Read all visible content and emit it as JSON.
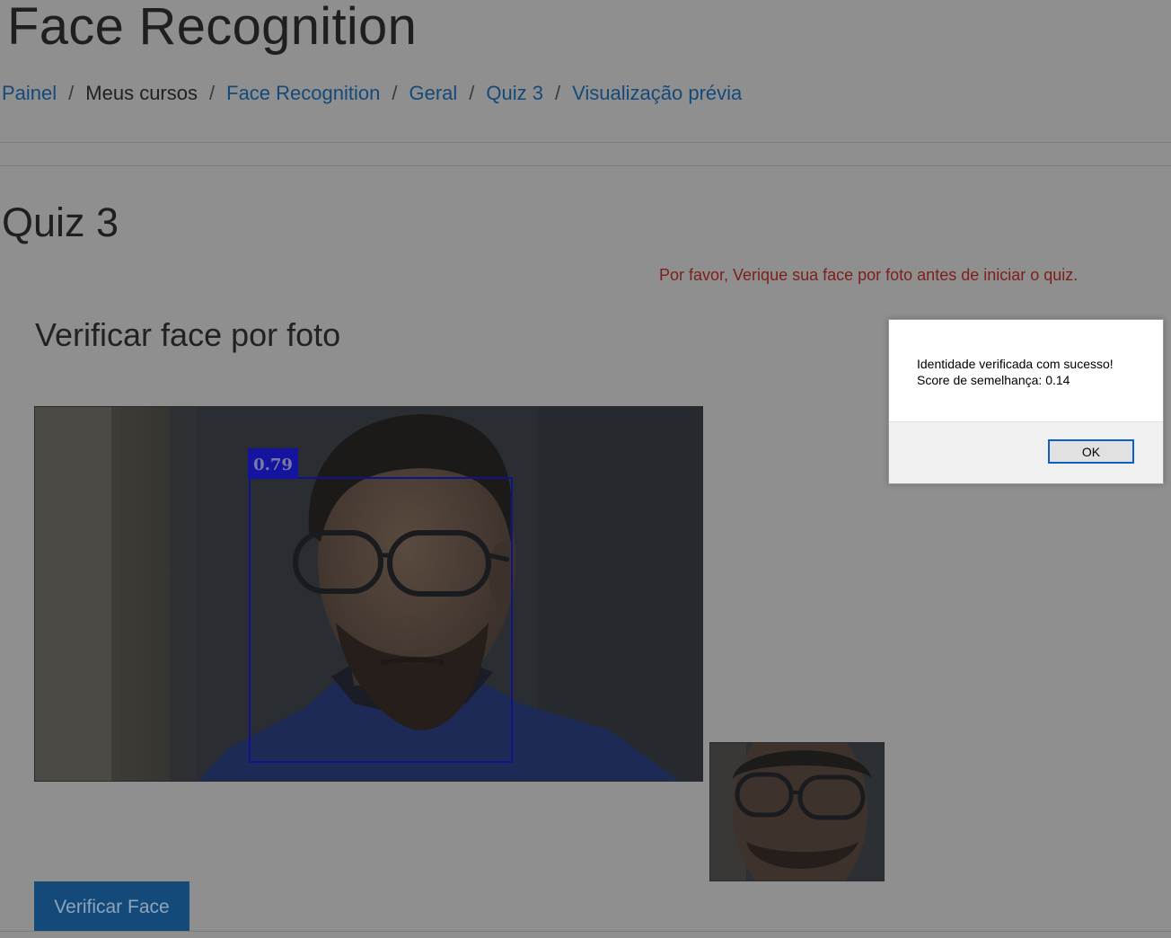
{
  "page": {
    "title": "Face Recognition"
  },
  "breadcrumb": {
    "items": [
      {
        "label": "Painel",
        "link": true
      },
      {
        "label": "Meus cursos",
        "link": false
      },
      {
        "label": "Face Recognition",
        "link": true
      },
      {
        "label": "Geral",
        "link": true
      },
      {
        "label": "Quiz 3",
        "link": true
      },
      {
        "label": "Visualização prévia",
        "link": true
      }
    ],
    "separator": "/"
  },
  "quiz": {
    "title": "Quiz 3",
    "warning": "Por favor, Verique sua face por foto antes de iniciar o quiz.",
    "section_title": "Verificar face por foto",
    "detection_score": "0.79",
    "verify_button": "Verificar Face"
  },
  "dialog": {
    "line1": "Identidade verificada com sucesso!",
    "line2": "Score de semelhança: 0.14",
    "ok_label": "OK"
  },
  "colors": {
    "overlay_background": "#8f8f8f",
    "link": "#144a7a",
    "warning": "#7d1f1a",
    "face_box": "#10128e",
    "primary_button": "#134a7a"
  }
}
